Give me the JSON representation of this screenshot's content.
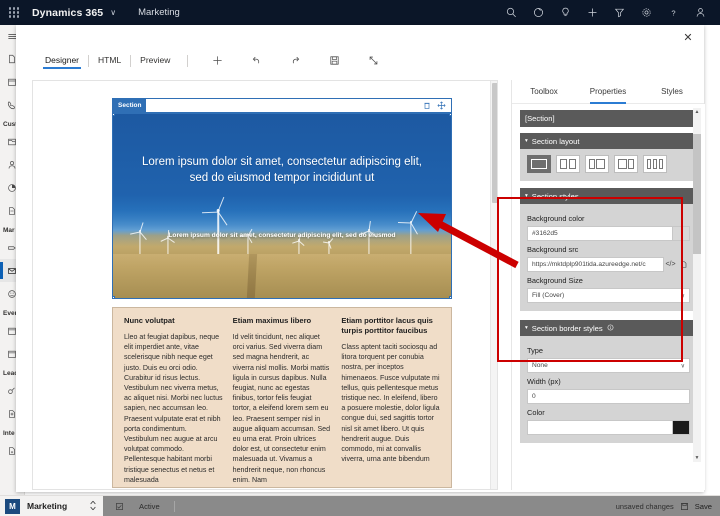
{
  "topnav": {
    "waffle_icon": "waffle-grid-icon",
    "brand": "Dynamics 365",
    "brand_caret": "∨",
    "app_name": "Marketing",
    "icons": [
      {
        "name": "search-icon"
      },
      {
        "name": "assistant-icon"
      },
      {
        "name": "lightbulb-icon"
      },
      {
        "name": "add-icon"
      },
      {
        "name": "filter-icon"
      },
      {
        "name": "settings-gear-icon"
      },
      {
        "name": "help-icon"
      },
      {
        "name": "user-account-icon"
      }
    ]
  },
  "rail": {
    "hamburger": "hamburger-icon",
    "groups": [
      {
        "label": "",
        "items": [
          "page-icon",
          "calendar-icon",
          "phone-icon"
        ]
      },
      {
        "label": "Cust",
        "items": [
          "accounts-icon",
          "contacts-icon",
          "segments-icon",
          "pages-icon"
        ]
      },
      {
        "label": "Mar",
        "items": [
          "customer-journey-icon",
          "email-icon",
          "social-icon"
        ]
      },
      {
        "label": "Ever",
        "items": [
          "events-icon",
          "event-calendar-icon"
        ]
      },
      {
        "label": "Leac",
        "items": [
          "leads-icon",
          "lead-scoring-icon"
        ]
      },
      {
        "label": "Inte",
        "items": [
          "forms-icon"
        ]
      }
    ]
  },
  "designer": {
    "close_label": "✕",
    "tabs": [
      {
        "label": "Designer",
        "active": true
      },
      {
        "label": "HTML",
        "active": false
      },
      {
        "label": "Preview",
        "active": false
      }
    ],
    "tools": [
      {
        "name": "add-element-button",
        "glyph": "+"
      },
      {
        "name": "undo-button",
        "glyph": "↶"
      },
      {
        "name": "redo-button",
        "glyph": "↷"
      },
      {
        "name": "save-button",
        "glyph": "Ὃe"
      },
      {
        "name": "fullscreen-button",
        "glyph": "⤡"
      }
    ]
  },
  "canvas": {
    "section_tag": "Section",
    "section_tools": [
      {
        "name": "delete-section-icon"
      },
      {
        "name": "move-section-icon"
      }
    ],
    "hero": {
      "headline": "Lorem ipsum dolor sit amet, consectetur adipiscing elit, sed do eiusmod tempor incididunt ut",
      "subhead": "Lorem ipsum dolor sit amet, consectetur adipiscing elit, sed do eiusmod"
    },
    "columns": [
      {
        "title": "Nunc volutpat",
        "body": "Lleo at feugiat dapibus, neque elit imperdiet ante, vitae scelerisque nibh neque eget justo. Duis eu orci odio. Curabitur id risus lectus. Vestibulum nec viverra metus, ac aliquet nisi. Morbi nec luctus sapien, nec accumsan leo. Praesent vulputate erat et nibh porta condimentum. Vestibulum nec augue at arcu volutpat commodo. Pellentesque habitant morbi tristique senectus et netus et malesuada"
      },
      {
        "title": "Etiam maximus libero",
        "body": "Id velit tincidunt, nec aliquet orci varius. Sed viverra diam sed magna hendrerit, ac viverra nisl mollis. Morbi mattis ligula in cursus dapibus. Nulla feugiat, nunc ac egestas finibus, tortor felis feugiat tortor, a eleifend lorem sem eu leo. Praesent semper nisl in augue aliquam accumsan. Sed eu urna erat. Proin ultrices dolor est, ut consectetur enim malesuada ut. Vivamus a hendrerit neque, non rhoncus enim. Nam"
      },
      {
        "title": "Etiam porttitor lacus quis turpis porttitor faucibus",
        "body": "Class aptent taciti sociosqu ad litora torquent per conubia nostra, per inceptos himenaeos. Fusce vulputate mi tellus, quis pellentesque metus tristique nec. In eleifend, libero a posuere molestie, dolor ligula congue dui, sed sagittis tortor nisl sit amet libero. Ut quis hendrerit augue. Duis commodo, mi at convallis viverra, urna ante bibendum"
      }
    ]
  },
  "properties": {
    "tabs": [
      {
        "label": "Toolbox",
        "active": false
      },
      {
        "label": "Properties",
        "active": true
      },
      {
        "label": "Styles",
        "active": false
      }
    ],
    "selected_element": "[Section]",
    "section_layout": {
      "title": "Section layout",
      "caret": "▾",
      "options": [
        {
          "name": "layout-1-column",
          "cols": 1,
          "selected": true
        },
        {
          "name": "layout-2-column-equal",
          "cols": 2,
          "selected": false
        },
        {
          "name": "layout-2-column-left",
          "cols": 2,
          "selected": false
        },
        {
          "name": "layout-2-column-right",
          "cols": 2,
          "selected": false
        },
        {
          "name": "layout-3-column",
          "cols": 3,
          "selected": false
        }
      ]
    },
    "section_styles": {
      "title": "Section styles",
      "caret": "▾",
      "background_color_label": "Background color",
      "background_color_value": "#3162d5",
      "background_src_label": "Background src",
      "background_src_value": "https://mktdplp901tida.azureedge.net/c",
      "code_icon": "</>",
      "file_icon": "file-picker-icon",
      "background_size_label": "Background Size",
      "background_size_value": "Fill (Cover)",
      "chevron": "∨"
    },
    "section_border_styles": {
      "title": "Section border styles",
      "caret": "▾",
      "info_icon": "info-icon",
      "type_label": "Type",
      "type_value": "None",
      "width_label": "Width (px)",
      "width_value": "0",
      "color_label": "Color",
      "chevron": "∨"
    }
  },
  "bottombar": {
    "logo": "M",
    "app": "Marketing",
    "chevron": "⌃",
    "status_icon": "save-state-icon",
    "status": "Active",
    "unsaved": "unsaved changes",
    "save_label": "Save",
    "save_icon": "save-disk-icon"
  },
  "annotation": {
    "arrow_color": "#cc0000",
    "highlight_color": "#cc0000"
  }
}
